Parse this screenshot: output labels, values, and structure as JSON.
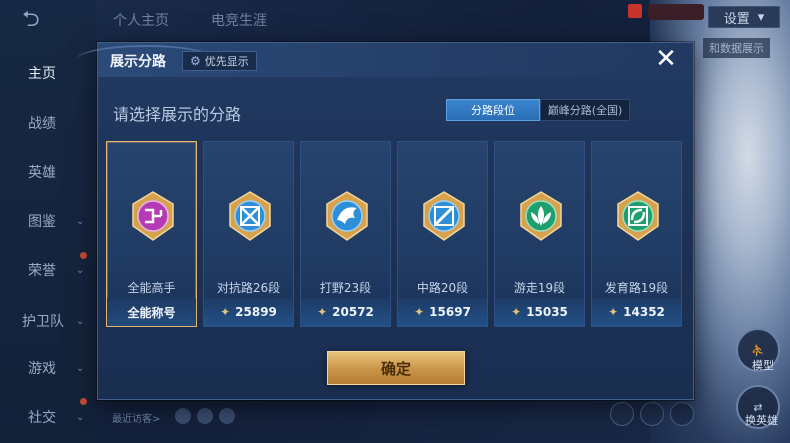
{
  "background": {
    "top_tabs": [
      "个人主页",
      "电竞生涯"
    ],
    "settings_label": "设置",
    "data_tag": "和数据展示",
    "sidebar": {
      "items": [
        {
          "label": "主页",
          "active": true
        },
        {
          "label": "战绩",
          "active": false
        },
        {
          "label": "英雄",
          "active": false
        },
        {
          "label": "图鉴",
          "active": false
        },
        {
          "label": "荣誉",
          "active": false
        },
        {
          "label": "护卫队",
          "active": false
        },
        {
          "label": "游戏",
          "active": false
        },
        {
          "label": "社交",
          "active": false
        }
      ]
    },
    "recent_visitors_label": "最近访客>",
    "right_buttons": {
      "model_label": "模型",
      "switch_hero_label": "换英雄"
    }
  },
  "modal": {
    "title": "展示分路",
    "priority_label": "优先显示",
    "subtitle": "请选择展示的分路",
    "segments": [
      {
        "label": "分路段位",
        "active": true
      },
      {
        "label": "巅峰分路(全国)",
        "active": false
      }
    ],
    "cards": [
      {
        "name": "全能高手",
        "bottom_text": "全能称号",
        "score": null,
        "selected": true,
        "emblem": "all-round-emblem",
        "color": "#b53bb5"
      },
      {
        "name": "对抗路26段",
        "bottom_text": null,
        "score": "25899",
        "selected": false,
        "emblem": "clash-lane-emblem",
        "color": "#2d8fd8"
      },
      {
        "name": "打野23段",
        "bottom_text": null,
        "score": "20572",
        "selected": false,
        "emblem": "jungle-emblem",
        "color": "#2d8fd8"
      },
      {
        "name": "中路20段",
        "bottom_text": null,
        "score": "15697",
        "selected": false,
        "emblem": "mid-lane-emblem",
        "color": "#2d8fd8"
      },
      {
        "name": "游走19段",
        "bottom_text": null,
        "score": "15035",
        "selected": false,
        "emblem": "roam-emblem",
        "color": "#1f9e6e"
      },
      {
        "name": "发育路19段",
        "bottom_text": null,
        "score": "14352",
        "selected": false,
        "emblem": "farm-lane-emblem",
        "color": "#1f9e6e"
      }
    ],
    "confirm_label": "确定",
    "close_icon": "close-icon"
  }
}
